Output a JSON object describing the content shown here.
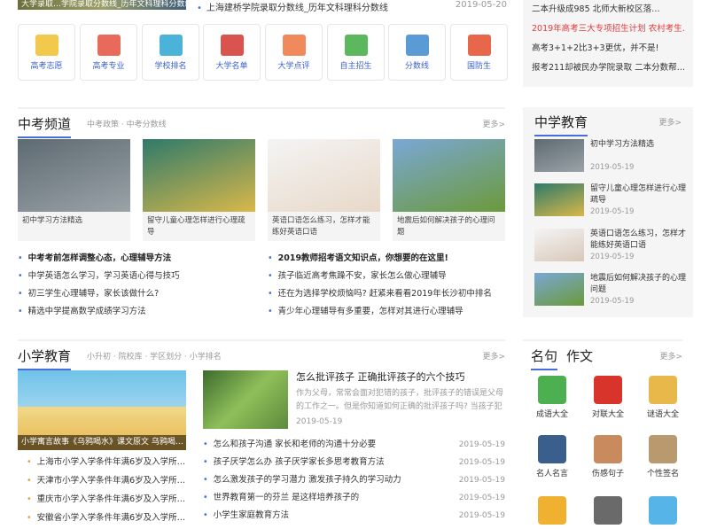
{
  "top": {
    "banner_caption": "大学录取…学院录取分数线_历年文科理科分数线",
    "news_text": "上海建桥学院录取分数线_历年文科理科分数线",
    "news_date": "2019-05-20"
  },
  "icon_nav": [
    {
      "label": "高考志愿",
      "icon": "volunteer-icon",
      "color": "#f2c94c"
    },
    {
      "label": "高考专业",
      "icon": "major-icon",
      "color": "#e86a5a"
    },
    {
      "label": "学校排名",
      "icon": "ranking-icon",
      "color": "#4bb3d9"
    },
    {
      "label": "大学名单",
      "icon": "books-icon",
      "color": "#d9534f"
    },
    {
      "label": "大学点评",
      "icon": "review-icon",
      "color": "#f08a5d"
    },
    {
      "label": "自主招生",
      "icon": "globe-icon",
      "color": "#5cb85c"
    },
    {
      "label": "分数线",
      "icon": "score-icon",
      "color": "#5b9bd5"
    },
    {
      "label": "国防生",
      "icon": "flag-icon",
      "color": "#e8674a"
    }
  ],
  "right_top": [
    {
      "text": "二本升级成985 北师大新校区落…",
      "red": false
    },
    {
      "text": "2019年高考三大专项招生计划 农村考生…",
      "red": true
    },
    {
      "text": "高考3+1+2比3+3更优，并不是!",
      "red": false
    },
    {
      "text": "报考211却被民办学院录取 二本分数帮…",
      "red": false
    }
  ],
  "zhongkao": {
    "title": "中考频道",
    "subs": "中考政策  ·  中考分数线",
    "more": "更多>",
    "cards": [
      {
        "caption": "初中学习方法精选",
        "color1": "#5e6a72",
        "color2": "#9aa3a8"
      },
      {
        "caption": "留守儿童心理怎样进行心理疏导",
        "color1": "#2e7a6a",
        "color2": "#d9b84a"
      },
      {
        "caption": "英语口语怎么练习，怎样才能练好英语口语",
        "color1": "#f4f4f4",
        "color2": "#e8d8c8"
      },
      {
        "caption": "地震后如何解决孩子的心理问题",
        "color1": "#7aa7d6",
        "color2": "#6b9a3a"
      }
    ],
    "list_left": [
      {
        "text": "中考考前怎样调整心态，心理辅导方法",
        "bold": true
      },
      {
        "text": "中学英语怎么学习，学习英语心得与技巧",
        "bold": false
      },
      {
        "text": "初三学生心理辅导，家长该做什么?",
        "bold": false
      },
      {
        "text": "精选中学提高数学成绩学习方法",
        "bold": false
      }
    ],
    "list_right": [
      {
        "text": "2019教师招考语文知识点，你想要的在这里!",
        "bold": true
      },
      {
        "text": "孩子临近高考焦躁不安，家长怎么做心理辅导",
        "bold": false
      },
      {
        "text": "还在为选择学校烦恼吗? 赶紧来看看2019年长沙初中排名",
        "bold": false
      },
      {
        "text": "青少年心理辅导有多重要，怎样对其进行心理辅导",
        "bold": false
      }
    ]
  },
  "middle_school": {
    "title": "中学教育",
    "more": "更多>",
    "items": [
      {
        "title": "初中学习方法精选",
        "date": "2019-05-19",
        "color1": "#5e6a72",
        "color2": "#9aa3a8"
      },
      {
        "title": "留守儿童心理怎样进行心理疏导",
        "date": "2019-05-19",
        "color1": "#2e7a6a",
        "color2": "#d9b84a"
      },
      {
        "title": "英语口语怎么练习，怎样才能练好英语口语",
        "date": "2019-05-19",
        "color1": "#f4f4f4",
        "color2": "#d8c8b8"
      },
      {
        "title": "地震后如何解决孩子的心理问题",
        "date": "2019-05-19",
        "color1": "#7aa7d6",
        "color2": "#6b9a3a"
      }
    ]
  },
  "primary": {
    "title": "小学教育",
    "subs": "小升初  ·  院校库  ·  学区划分  ·  小学排名",
    "more": "更多>",
    "main_caption": "小学寓言故事《乌鸦喝水》课文原文 乌鸦喝…",
    "feature_title": "怎么批评孩子 正确批评孩子的六个技巧",
    "feature_desc": "作为父母，常常会面对犯错的孩子，批评孩子的错误是父母的工作之一。但是你知道如何正确的批评孩子吗? 当孩子犯",
    "feature_date": "2019-05-19",
    "list_left": [
      "上海市小学入学条件年满6岁及入学所…",
      "天津市小学入学条件年满6岁及入学所…",
      "重庆市小学入学条件年满6岁及入学所…",
      "安徽省小学入学条件年满6岁及入学所…"
    ],
    "list_right": [
      {
        "text": "怎么和孩子沟通 家长和老师的沟通十分必要",
        "date": "2019-05-19"
      },
      {
        "text": "孩子厌学怎么办 孩子厌学家长多思考教育方法",
        "date": "2019-05-19"
      },
      {
        "text": "怎么激发孩子的学习潜力 激发孩子持久的学习动力",
        "date": "2019-05-19"
      },
      {
        "text": "世界教育第一的芬兰 是这样培养孩子的",
        "date": "2019-05-19"
      },
      {
        "text": "小学生家庭教育方法",
        "date": "2019-05-19"
      }
    ]
  },
  "literature": {
    "tab1": "名句",
    "tab2": "作文",
    "more": "更多>",
    "items": [
      {
        "label": "成语大全",
        "color": "#4caf50"
      },
      {
        "label": "对联大全",
        "color": "#d9342b"
      },
      {
        "label": "谜语大全",
        "color": "#e8b84a"
      },
      {
        "label": "名人名言",
        "color": "#3b5f8c"
      },
      {
        "label": "伤感句子",
        "color": "#c98a5e"
      },
      {
        "label": "个性签名",
        "color": "#b89a6e"
      },
      {
        "label": "",
        "color": "#f0b030"
      },
      {
        "label": "",
        "color": "#6a6a6a"
      },
      {
        "label": "",
        "color": "#56b4e9"
      }
    ]
  }
}
